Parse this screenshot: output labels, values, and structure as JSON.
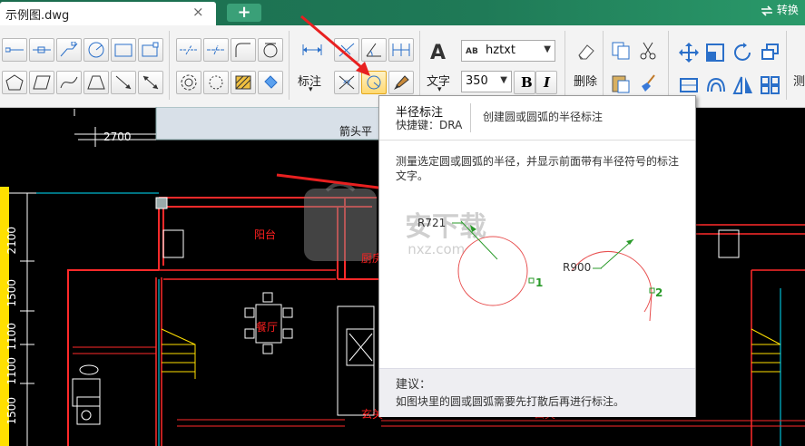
{
  "tabs": {
    "active_title": "示例图.dwg",
    "close_glyph": "×",
    "add_glyph": "+",
    "convert_label": "转换",
    "convert_icon": "swap-arrows-icon"
  },
  "ribbon": {
    "annotate_label": "标注",
    "text_label": "文字",
    "text_icon_glyph": "A",
    "delete_label": "删除",
    "measure_label": "测",
    "font_name": "hztxt",
    "font_size": "350",
    "bold_glyph": "B",
    "italic_glyph": "I",
    "combo_arrow": "▼",
    "dropdown_arrow": "▾"
  },
  "drawing": {
    "panel_label": "箭头平",
    "dim_top": "2700",
    "left_dims": [
      "2100",
      "1500",
      "1100",
      "1100",
      "1500"
    ],
    "rooms": {
      "balcony": "阳台",
      "kitchen": "厨房",
      "dining": "餐厅",
      "entrance": "玄关",
      "entrance_partial": "玄关"
    },
    "watermark_text": "安下载",
    "watermark_url": "anxz.com",
    "colors": {
      "wall": "#ff2a2a",
      "cyan": "#00e5ff",
      "yellow": "#ffe000",
      "arrow": "#e82020"
    }
  },
  "tooltip": {
    "title": "半径标注",
    "shortcut": "快捷键：DRA",
    "summary": "创建圆或圆弧的半径标注",
    "description": "测量选定圆或圆弧的半径，并显示前面带有半径符号的标注文字。",
    "example1_label": "R721",
    "example2_label": "R900",
    "point1": "1",
    "point2": "2",
    "advice_title": "建议：",
    "advice_text": "如图块里的圆或圆弧需要先打散后再进行标注。"
  }
}
